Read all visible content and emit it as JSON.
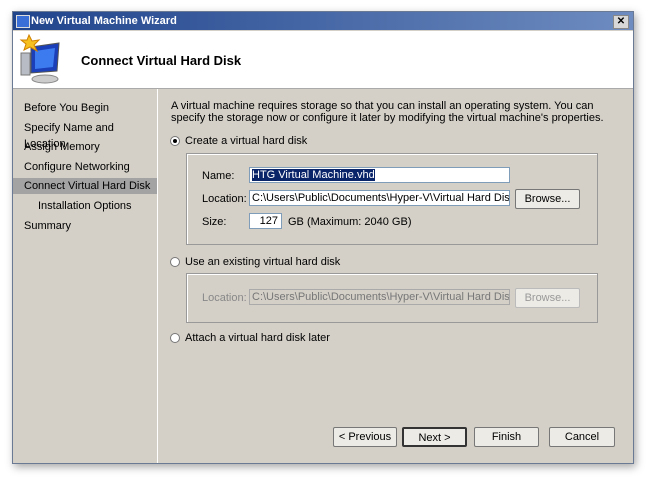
{
  "window": {
    "title": "New Virtual Machine Wizard",
    "close": "✕"
  },
  "header": {
    "title": "Connect Virtual Hard Disk"
  },
  "sidebar": {
    "items": [
      {
        "label": "Before You Begin"
      },
      {
        "label": "Specify Name and Location"
      },
      {
        "label": "Assign Memory"
      },
      {
        "label": "Configure Networking"
      },
      {
        "label": "Connect Virtual Hard Disk",
        "selected": true
      },
      {
        "label": "Installation Options"
      },
      {
        "label": "Summary"
      }
    ]
  },
  "main": {
    "description": "A virtual machine requires storage so that you can install an operating system. You can specify the storage now or configure it later by modifying the virtual machine's properties.",
    "create": {
      "label": "Create a virtual hard disk",
      "name_label": "Name:",
      "name_value": "HTG Virtual Machine.vhd",
      "location_label": "Location:",
      "location_value": "C:\\Users\\Public\\Documents\\Hyper-V\\Virtual Hard Disks\\",
      "browse": "Browse...",
      "size_label": "Size:",
      "size_value": "127",
      "size_hint": "GB (Maximum: 2040 GB)"
    },
    "existing": {
      "label": "Use an existing virtual hard disk",
      "location_label": "Location:",
      "location_value": "C:\\Users\\Public\\Documents\\Hyper-V\\Virtual Hard Disks\\",
      "browse": "Browse..."
    },
    "later": {
      "label": "Attach a virtual hard disk later"
    }
  },
  "buttons": {
    "previous": "< Previous",
    "next": "Next >",
    "finish": "Finish",
    "cancel": "Cancel"
  }
}
